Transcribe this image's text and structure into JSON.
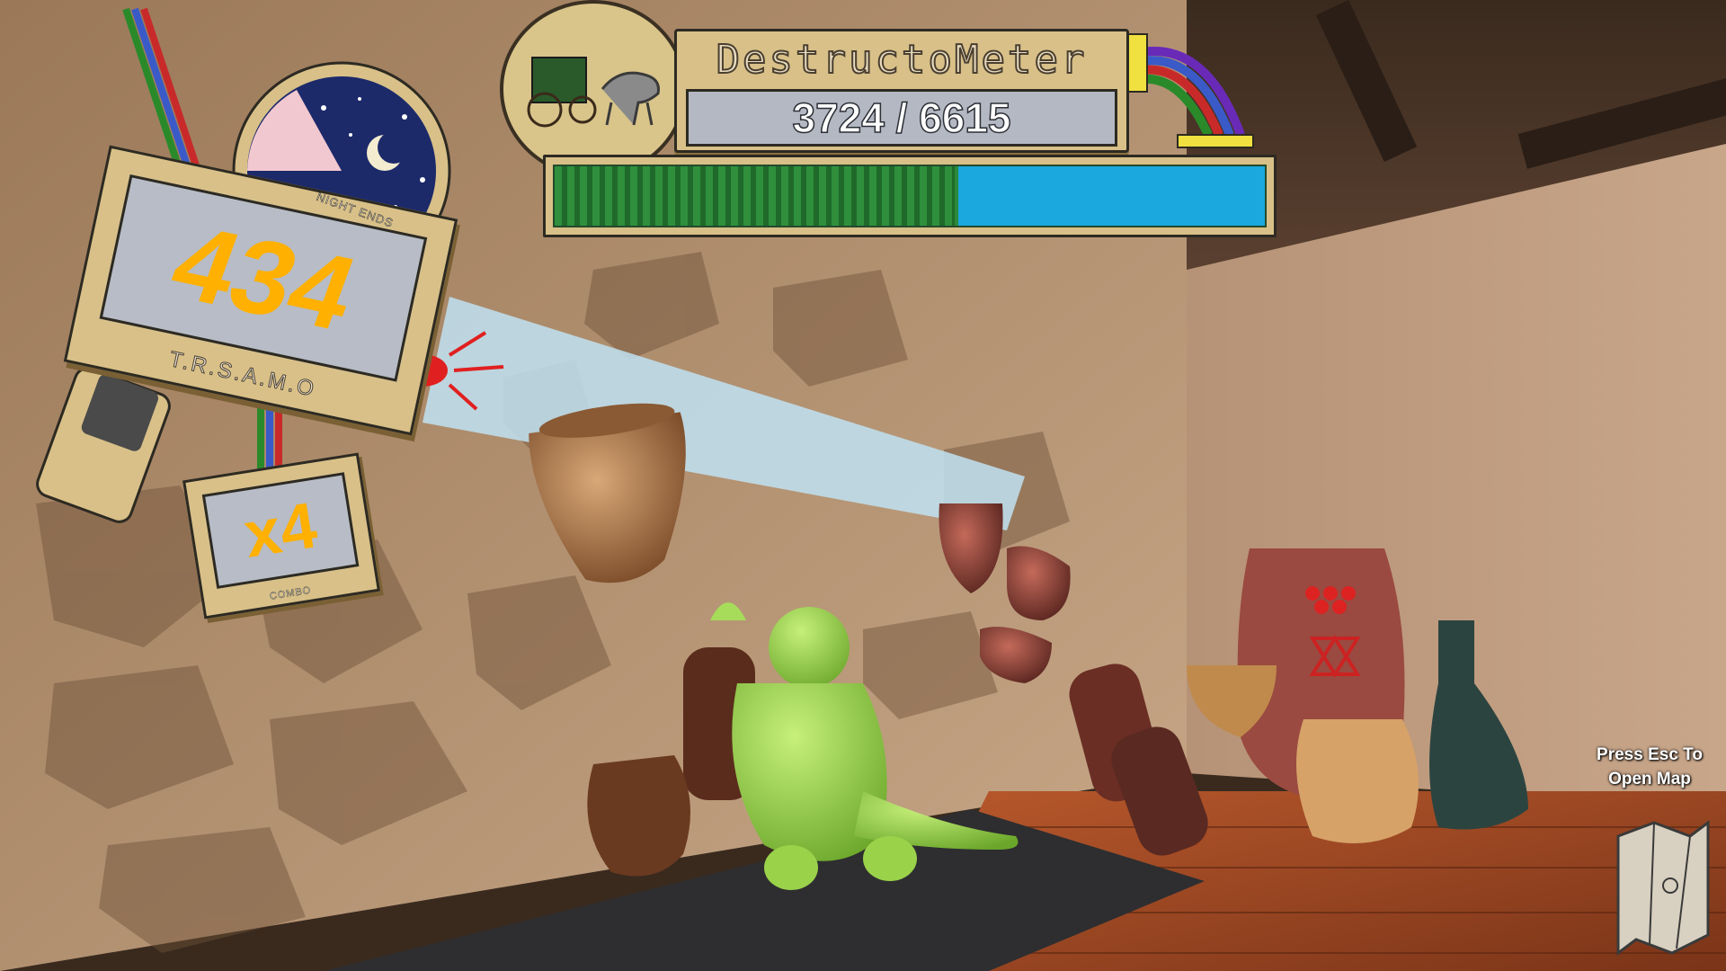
{
  "hud": {
    "destructometer": {
      "title": "DestructoMeter",
      "current": 3724,
      "target": 6615,
      "readout": "3724 / 6615",
      "progress_fraction": 0.563,
      "icon": "horse-carriage-icon",
      "fill_color": "#2f8f3c",
      "remaining_color": "#1aa8de"
    },
    "score": {
      "value": "434",
      "caption": "T.R.S.A.M.O",
      "color": "#ffb000",
      "night_caption": "NIGHT ENDS"
    },
    "combo": {
      "value": "x4",
      "caption": "COMBO"
    },
    "night_clock_icon": "moon-stars-icon",
    "alarm_icon": "red-alarm-light-icon"
  },
  "map_hint": {
    "line1": "Press Esc To",
    "line2": "Open Map",
    "icon": "folded-map-icon"
  },
  "scene": {
    "player": "green-dinosaur",
    "objects": [
      "clay-vases",
      "amphorae",
      "wooden-floor",
      "stone-wall"
    ]
  }
}
